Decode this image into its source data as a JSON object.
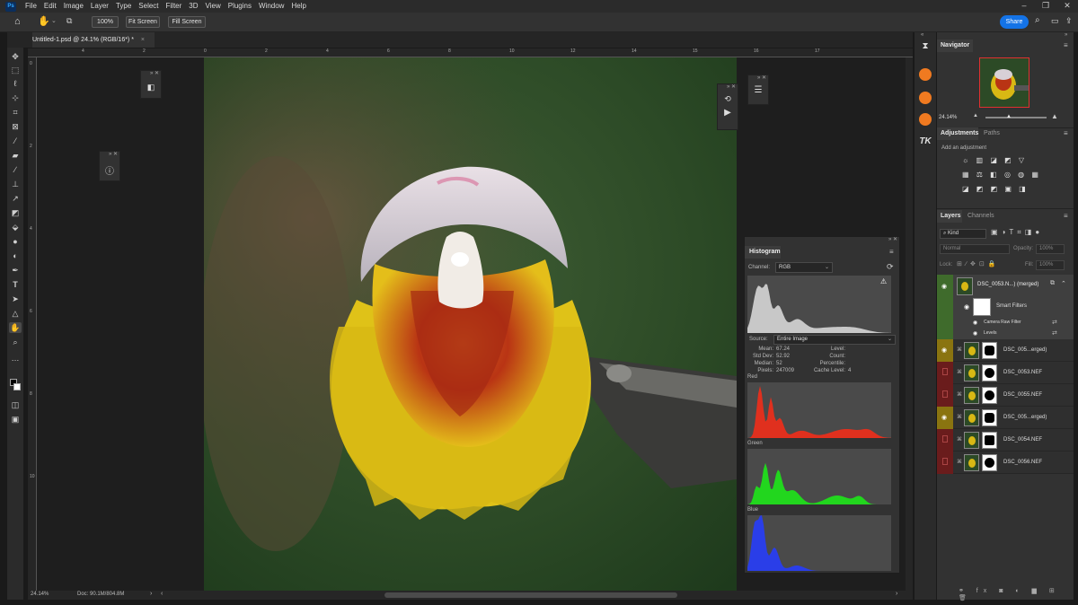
{
  "app": {
    "logo": "Ps",
    "menu": [
      "File",
      "Edit",
      "Image",
      "Layer",
      "Type",
      "Select",
      "Filter",
      "3D",
      "View",
      "Plugins",
      "Window",
      "Help"
    ]
  },
  "options_bar": {
    "zoom_button": "100%",
    "fit_screen": "Fit Screen",
    "fill_screen": "Fill Screen",
    "share": "Share"
  },
  "document": {
    "tab_title": "Untitled-1.psd @ 24.1% (RGB/16*) *",
    "close": "×"
  },
  "ruler": {
    "h_ticks": [
      "4",
      "2",
      "0",
      "2",
      "4",
      "6",
      "8",
      "10",
      "12",
      "14",
      "15",
      "16",
      "17"
    ],
    "v_ticks": [
      "0",
      "2",
      "4",
      "6",
      "8",
      "10"
    ]
  },
  "status": {
    "zoom": "24.14%",
    "doc": "Doc: 90.1M/804.8M"
  },
  "histogram": {
    "title": "Histogram",
    "channel_label": "Channel:",
    "channel_value": "RGB",
    "source_label": "Source:",
    "source_value": "Entire Image",
    "stats_left": [
      {
        "k": "Mean:",
        "v": "67.24"
      },
      {
        "k": "Std Dev:",
        "v": "52.92"
      },
      {
        "k": "Median:",
        "v": "52"
      },
      {
        "k": "Pixels:",
        "v": "247009"
      }
    ],
    "stats_right": [
      {
        "k": "Level:",
        "v": ""
      },
      {
        "k": "Count:",
        "v": ""
      },
      {
        "k": "Percentile:",
        "v": ""
      },
      {
        "k": "Cache Level:",
        "v": "4"
      }
    ],
    "channels": [
      "Red",
      "Green",
      "Blue"
    ],
    "colors": {
      "rgb": "#c8c8c8",
      "red": "#e0301e",
      "green": "#22d61e",
      "blue": "#2a3ee8"
    }
  },
  "navigator": {
    "title": "Navigator",
    "zoom": "24.14%"
  },
  "adjustments": {
    "tab_active": "Adjustments",
    "tab_other": "Paths",
    "add_label": "Add an adjustment"
  },
  "layers": {
    "tab_active": "Layers",
    "tab_other": "Channels",
    "filter_kind": "Kind",
    "blend_mode": "Normal",
    "opacity_label": "Opacity:",
    "opacity_value": "100%",
    "lock_label": "Lock:",
    "fill_label": "Fill:",
    "fill_value": "100%",
    "top_layer": "DSC_0053.N...) (merged)",
    "smart_filters": "Smart Filters",
    "filters": [
      "Camera Raw Filter",
      "Levels"
    ],
    "rows": [
      {
        "name": "DSC_005...erged)",
        "vis_color": "#8a7410",
        "visible": true
      },
      {
        "name": "DSC_0053.NEF",
        "vis_color": "#6a1c1c",
        "visible": false
      },
      {
        "name": "DSC_0055.NEF",
        "vis_color": "#6a1c1c",
        "visible": false
      },
      {
        "name": "DSC_005...erged)",
        "vis_color": "#8a7410",
        "visible": true
      },
      {
        "name": "DSC_0054.NEF",
        "vis_color": "#6a1c1c",
        "visible": false
      },
      {
        "name": "DSC_0056.NEF",
        "vis_color": "#6a1c1c",
        "visible": false
      }
    ]
  }
}
